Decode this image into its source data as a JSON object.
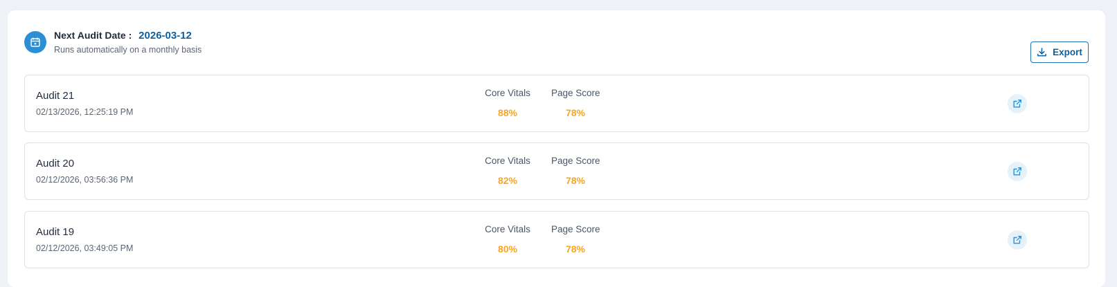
{
  "header": {
    "next_label": "Next Audit Date :",
    "next_date": "2026-03-12",
    "subtitle": "Runs automatically on a monthly basis",
    "export_label": "Export"
  },
  "audits": [
    {
      "title": "Audit 21",
      "timestamp": "02/13/2026, 12:25:19 PM",
      "core_vitals_label": "Core Vitals",
      "core_vitals": "88%",
      "page_score_label": "Page Score",
      "page_score": "78%"
    },
    {
      "title": "Audit 20",
      "timestamp": "02/12/2026, 03:56:36 PM",
      "core_vitals_label": "Core Vitals",
      "core_vitals": "82%",
      "page_score_label": "Page Score",
      "page_score": "78%"
    },
    {
      "title": "Audit 19",
      "timestamp": "02/12/2026, 03:49:05 PM",
      "core_vitals_label": "Core Vitals",
      "core_vitals": "80%",
      "page_score_label": "Page Score",
      "page_score": "78%"
    }
  ],
  "icons": {
    "calendar": "calendar-icon",
    "download": "download-icon",
    "open": "external-link-icon"
  },
  "colors": {
    "accent": "#2b8fd6",
    "date_text": "#0f5f9e",
    "score": "#f5a623"
  }
}
